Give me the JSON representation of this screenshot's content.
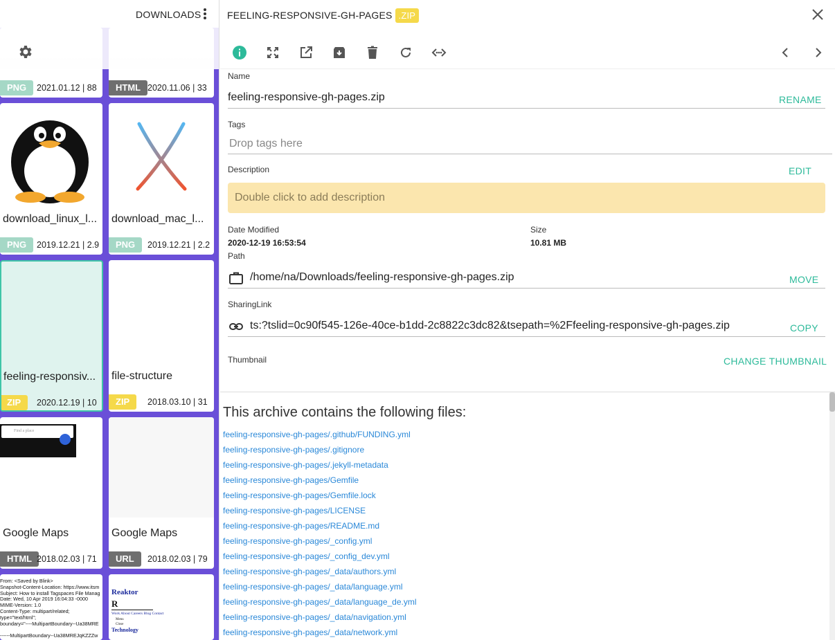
{
  "left_panel": {
    "title": "DOWNLOADS",
    "cells": [
      {
        "name": "",
        "tag": "PNG",
        "tag_color": "#a5d8c6",
        "meta": "2021.01.12 | 88"
      },
      {
        "name": "",
        "tag": "HTML",
        "tag_color": "#6f6f6f",
        "meta": "2020.11.06 | 33"
      },
      {
        "name": "download_linux_l...",
        "tag": "PNG",
        "tag_color": "#a5d8c6",
        "meta": "2019.12.21 | 2.9"
      },
      {
        "name": "download_mac_l...",
        "tag": "PNG",
        "tag_color": "#a5d8c6",
        "meta": "2019.12.21 | 2.2"
      },
      {
        "name": "feeling-responsiv...",
        "tag": "ZIP",
        "tag_color": "#f5d94a",
        "meta": "2020.12.19 | 10"
      },
      {
        "name": "file-structure",
        "tag": "ZIP",
        "tag_color": "#f5d94a",
        "meta": "2018.03.10 | 31"
      },
      {
        "name": "Google Maps",
        "tag": "HTML",
        "tag_color": "#6f6f6f",
        "meta": "2018.02.03 | 71"
      },
      {
        "name": "Google Maps",
        "tag": "URL",
        "tag_color": "#6f6f6f",
        "meta": "2018.02.03 | 79"
      }
    ],
    "maps_thumb_text": "Find a place",
    "mail_thumb_lines": [
      "From: <Saved by Blink>",
      "Snapshot-Content-Location: https://www.itsm",
      "Subject: How to install Tagspaces File Manag",
      "Date: Wed, 10 Apr 2019 16:04:33 -0000",
      "MIME-Version: 1.0",
      "Content-Type: multipart/related;",
      "type=\"text/html\";",
      "boundary=\"----MultipartBoundary--Ua38MRE",
      "",
      "------MultipartBoundary--Ua38MREJqKZZZw"
    ],
    "web_thumb": {
      "brand": "Reaktor",
      "logo": "R",
      "nav": "Work About Careers Blog Contact",
      "menu": "Menu",
      "close": "Close",
      "tech": "Technology"
    }
  },
  "detail": {
    "title": "FEELING-RESPONSIVE-GH-PAGES",
    "extension": ".ZIP",
    "name_label": "Name",
    "name_value": "feeling-responsive-gh-pages.zip",
    "rename": "RENAME",
    "tags_label": "Tags",
    "tags_placeholder": "Drop tags here",
    "description_label": "Description",
    "edit": "EDIT",
    "description_placeholder": "Double click to add description",
    "date_label": "Date Modified",
    "date_value": "2020-12-19 16:53:54",
    "size_label": "Size",
    "size_value": "10.81 MB",
    "path_label": "Path",
    "path_value": "/home/na/Downloads/feeling-responsive-gh-pages.zip",
    "move": "MOVE",
    "sharing_label": "SharingLink",
    "sharing_value": "ts:?tslid=0c90f545-126e-40ce-b1dd-2c8822c3dc82&tsepath=%2Ffeeling-responsive-gh-pages.zip",
    "copy": "COPY",
    "thumbnail_label": "Thumbnail",
    "change_thumbnail": "CHANGE THUMBNAIL",
    "accent": "#2dba9a"
  },
  "archive": {
    "title": "This archive contains the following files:",
    "files": [
      "feeling-responsive-gh-pages/.github/FUNDING.yml",
      "feeling-responsive-gh-pages/.gitignore",
      "feeling-responsive-gh-pages/.jekyll-metadata",
      "feeling-responsive-gh-pages/Gemfile",
      "feeling-responsive-gh-pages/Gemfile.lock",
      "feeling-responsive-gh-pages/LICENSE",
      "feeling-responsive-gh-pages/README.md",
      "feeling-responsive-gh-pages/_config.yml",
      "feeling-responsive-gh-pages/_config_dev.yml",
      "feeling-responsive-gh-pages/_data/authors.yml",
      "feeling-responsive-gh-pages/_data/language.yml",
      "feeling-responsive-gh-pages/_data/language_de.yml",
      "feeling-responsive-gh-pages/_data/navigation.yml",
      "feeling-responsive-gh-pages/_data/network.yml"
    ]
  }
}
